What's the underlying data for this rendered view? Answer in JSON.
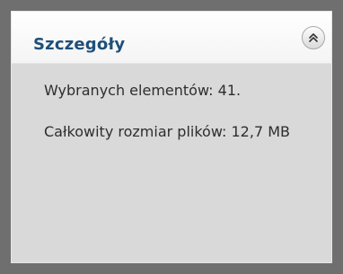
{
  "panel": {
    "title": "Szczegóły",
    "collapse_icon": "double-chevron-up-icon",
    "selected_items_text": "Wybranych elementów: 41.",
    "total_size_text": "Całkowity rozmiar plików: 12,7 MB"
  },
  "colors": {
    "title": "#1f4f78",
    "body_text": "#2e2e2e",
    "panel_background": "#d9d9d9",
    "frame_background": "#6f6f6f"
  }
}
